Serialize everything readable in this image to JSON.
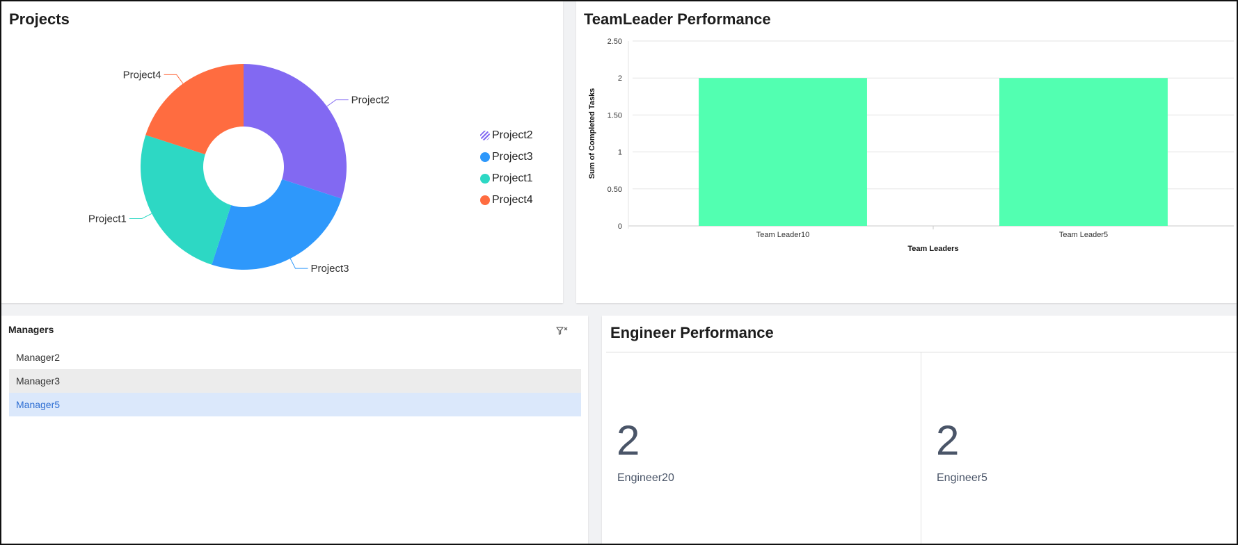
{
  "projects": {
    "title": "Projects",
    "colors": {
      "Project2": "#8269f2",
      "Project3": "#2e98fb",
      "Project1": "#2dd8c4",
      "Project4": "#ff6c40"
    },
    "legend": [
      {
        "label": "Project2",
        "style": "hatched"
      },
      {
        "label": "Project3",
        "style": "solid"
      },
      {
        "label": "Project1",
        "style": "solid"
      },
      {
        "label": "Project4",
        "style": "solid"
      }
    ]
  },
  "teamleader": {
    "title": "TeamLeader Performance",
    "bar_color": "#52ffb1"
  },
  "managers": {
    "title": "Managers",
    "items": [
      "Manager2",
      "Manager3",
      "Manager5"
    ],
    "hovered": "Manager3",
    "selected": "Manager5"
  },
  "engineer": {
    "title": "Engineer Performance",
    "kpis": [
      {
        "value": "2",
        "label": "Engineer20"
      },
      {
        "value": "2",
        "label": "Engineer5"
      }
    ]
  },
  "chart_data": [
    {
      "type": "pie",
      "title": "Projects",
      "donut": true,
      "categories": [
        "Project2",
        "Project3",
        "Project1",
        "Project4"
      ],
      "values": [
        30,
        25,
        25,
        20
      ],
      "legend": "right"
    },
    {
      "type": "bar",
      "title": "TeamLeader Performance",
      "categories": [
        "Team Leader10",
        "Team Leader5"
      ],
      "values": [
        2,
        2
      ],
      "xlabel": "Team Leaders",
      "ylabel": "Sum of Completed Tasks",
      "ylim": [
        0,
        2.5
      ],
      "yticks": [
        "0",
        "0.50",
        "1",
        "1.50",
        "2",
        "2.50"
      ],
      "grid": true
    }
  ]
}
